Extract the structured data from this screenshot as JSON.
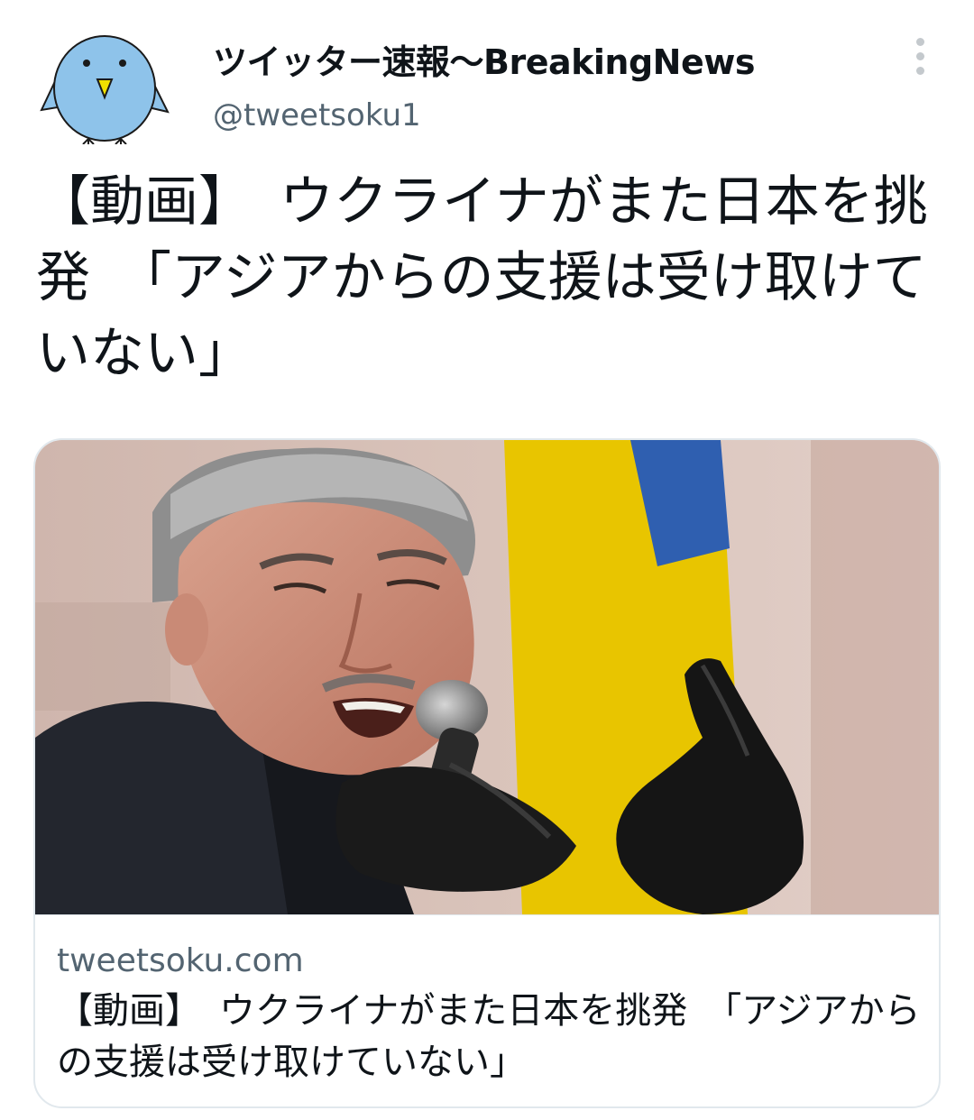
{
  "tweet": {
    "display_name": "ツイッター速報〜BreakingNews",
    "handle": "@tweetsoku1",
    "text": "【動画】　ウクライナがまた日本を挑発　「アジアからの支援は受け取けていない」"
  },
  "card": {
    "domain": "tweetsoku.com",
    "title": "【動画】　ウクライナがまた日本を挑発　「アジアからの支援は受け取けていない」"
  },
  "icons": {
    "avatar": "blue-bird-avatar",
    "more": "more-vertical-icon"
  },
  "colors": {
    "secondary_text": "#536471",
    "avatar_bird": "#8ec3ea",
    "beak": "#f0e000",
    "flag_yellow": "#e8c500",
    "flag_blue": "#2f5fb0"
  }
}
